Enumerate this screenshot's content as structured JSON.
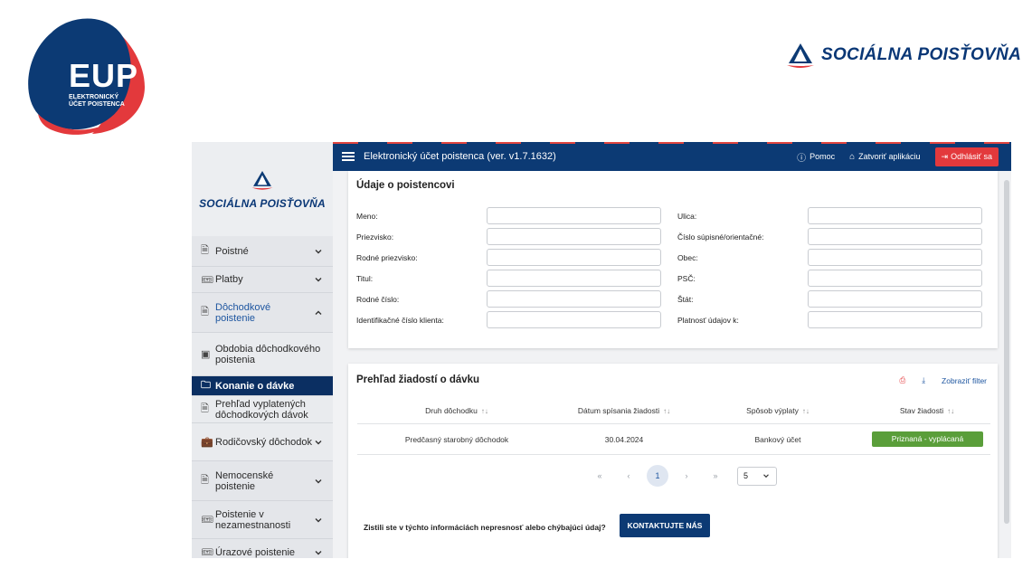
{
  "eup_logo": {
    "big": "EUP",
    "line1": "ELEKTRONICKÝ",
    "line2": "ÚČET POISTENCA"
  },
  "brand": {
    "name": "SOCIÁLNA POISŤOVŇA"
  },
  "sidebar": {
    "logo_text": "SOCIÁLNA POISŤOVŇA",
    "items": [
      {
        "label": "Poistné",
        "icon": "document-icon",
        "chevron": "down"
      },
      {
        "label": "Platby",
        "icon": "ticket-icon",
        "chevron": "down"
      },
      {
        "label": "Dôchodkové poistenie",
        "icon": "document-icon",
        "chevron": "up",
        "expanded": true
      },
      {
        "label": "Obdobia dôchodkového poistenia",
        "icon": "calendar-id-icon",
        "sub": true
      },
      {
        "label": "Konanie o dávke",
        "icon": "folder-icon",
        "sub": true,
        "active": true
      },
      {
        "label": "Prehľad vyplatených dôchodkových dávok",
        "icon": "document-icon",
        "sub": true
      },
      {
        "label": "Rodičovský dôchodok",
        "icon": "briefcase-icon",
        "sub": true,
        "chevron": "down"
      },
      {
        "label": "Nemocenské poistenie",
        "icon": "document-icon",
        "chevron": "down"
      },
      {
        "label": "Poistenie v nezamestnanosti",
        "icon": "ticket-icon",
        "chevron": "down"
      },
      {
        "label": "Úrazové poistenie",
        "icon": "ticket-icon",
        "chevron": "down"
      }
    ]
  },
  "topbar": {
    "title": "Elektronický účet poistenca (ver. v1.7.1632)",
    "help": "Pomoc",
    "close_app": "Zatvoriť aplikáciu",
    "logout": "Odhlásiť sa"
  },
  "insured": {
    "title": "Údaje o poistencovi",
    "left_fields": [
      "Meno:",
      "Priezvisko:",
      "Rodné priezvisko:",
      "Titul:",
      "Rodné číslo:",
      "Identifikačné číslo klienta:"
    ],
    "right_fields": [
      "Ulica:",
      "Číslo súpisné/orientačné:",
      "Obec:",
      "PSČ:",
      "Štát:",
      "Platnosť údajov k:"
    ]
  },
  "requests": {
    "title": "Prehľad žiadostí o dávku",
    "show_filter": "Zobraziť filter",
    "columns": [
      "Druh dôchodku",
      "Dátum spísania žiadosti",
      "Spôsob výplaty",
      "Stav žiadosti"
    ],
    "sort_icon": "↑↓",
    "rows": [
      {
        "type": "Predčasný starobný dôchodok",
        "date": "30.04.2024",
        "payment": "Bankový účet",
        "status": "Priznaná - vyplácaná"
      }
    ],
    "pager": {
      "first": "«",
      "prev": "‹",
      "current": "1",
      "next": "›",
      "last": "»",
      "page_size": "5"
    },
    "contact_question": "Zistili ste v týchto informáciách nepresnosť alebo chýbajúci údaj?",
    "contact_button": "KONTAKTUJTE NÁS"
  },
  "colors": {
    "navy": "#0c3a74",
    "red": "#e3393c",
    "green": "#5a9e3a",
    "sidebar": "#e4e6ea"
  }
}
